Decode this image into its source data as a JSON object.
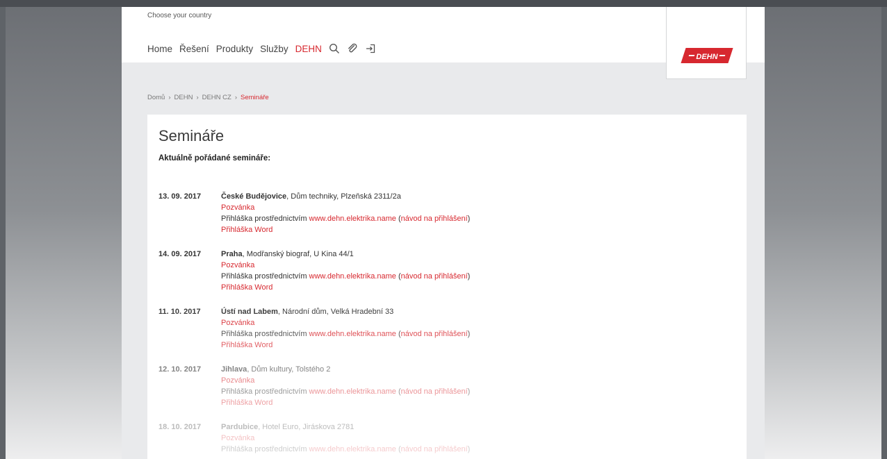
{
  "header": {
    "country_label": "Choose your country",
    "nav": [
      "Home",
      "Řešení",
      "Produkty",
      "Služby",
      "DEHN"
    ],
    "nav_active_index": 4,
    "icons": [
      "search-icon",
      "paperclip-icon",
      "login-icon"
    ]
  },
  "logo": {
    "text": "DEHN",
    "color": "#d7282f"
  },
  "breadcrumb": [
    "Domů",
    "DEHN",
    "DEHN CZ",
    "Semináře"
  ],
  "page": {
    "title": "Semináře",
    "subtitle": "Aktuálně pořádané semináře:"
  },
  "seminars": [
    {
      "date": "13. 09. 2017",
      "city": "České Budějovice",
      "place": ", Dům techniky, Plzeňská 2311/2a",
      "invitation": "Pozvánka",
      "reg_text": "Přihláška prostřednictvím ",
      "reg_link": "www.dehn.elektrika.name",
      "guide_open": " (",
      "guide_link": "návod na přihlášení",
      "guide_close": ")",
      "word": "Přihláška Word"
    },
    {
      "date": "14. 09. 2017",
      "city": "Praha",
      "place": ", Modřanský biograf, U Kina 44/1",
      "invitation": "Pozvánka",
      "reg_text": "Přihláška prostřednictvím ",
      "reg_link": "www.dehn.elektrika.name",
      "guide_open": " (",
      "guide_link": "návod na přihlášení",
      "guide_close": ")",
      "word": "Přihláška Word"
    },
    {
      "date": "11. 10. 2017",
      "city": "Ústí nad Labem",
      "place": ", Národní dům, Velká Hradební 33",
      "invitation": "Pozvánka",
      "reg_text": "Přihláška prostřednictvím ",
      "reg_link": "www.dehn.elektrika.name",
      "guide_open": " (",
      "guide_link": "návod na přihlášení",
      "guide_close": ")",
      "word": "Přihláška Word"
    },
    {
      "date": "12. 10. 2017",
      "city": "Jihlava",
      "place": ", Dům kultury, Tolstého 2",
      "invitation": "Pozvánka",
      "reg_text": "Přihláška prostřednictvím ",
      "reg_link": "www.dehn.elektrika.name",
      "guide_open": " (",
      "guide_link": "návod na přihlášení",
      "guide_close": ")",
      "word": "Přihláška Word"
    },
    {
      "date": "18. 10. 2017",
      "city": "Pardubice",
      "place": ", Hotel Euro, Jiráskova 2781",
      "invitation": "Pozvánka",
      "reg_text": "Přihláška prostřednictvím ",
      "reg_link": "www.dehn.elektrika.name",
      "guide_open": " (",
      "guide_link": "návod na přihlášení",
      "guide_close": ")",
      "word": ""
    }
  ],
  "colors": {
    "accent": "#d7282f",
    "page_bg": "#e9eaec",
    "outer_bg": "#6c6f74"
  }
}
